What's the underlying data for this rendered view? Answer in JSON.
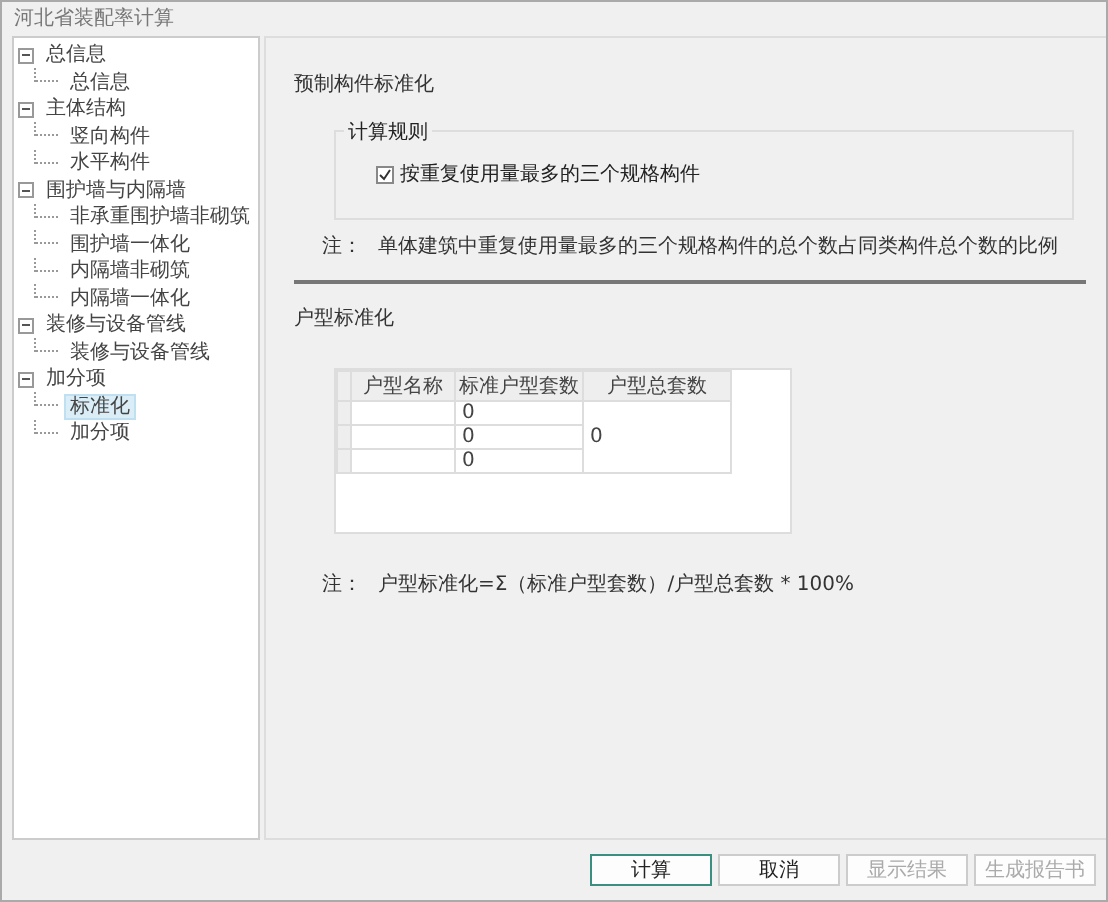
{
  "window": {
    "title": "河北省装配率计算"
  },
  "sidebar": {
    "items": [
      {
        "label": "总信息",
        "expanded": true,
        "selected": false,
        "children": [
          {
            "label": "总信息",
            "selected": false
          }
        ]
      },
      {
        "label": "主体结构",
        "expanded": true,
        "selected": false,
        "children": [
          {
            "label": "竖向构件",
            "selected": false
          },
          {
            "label": "水平构件",
            "selected": false
          }
        ]
      },
      {
        "label": "围护墙与内隔墙",
        "expanded": true,
        "selected": false,
        "children": [
          {
            "label": "非承重围护墙非砌筑",
            "selected": false
          },
          {
            "label": "围护墙一体化",
            "selected": false
          },
          {
            "label": "内隔墙非砌筑",
            "selected": false
          },
          {
            "label": "内隔墙一体化",
            "selected": false
          }
        ]
      },
      {
        "label": "装修与设备管线",
        "expanded": true,
        "selected": false,
        "children": [
          {
            "label": "装修与设备管线",
            "selected": false
          }
        ]
      },
      {
        "label": "加分项",
        "expanded": true,
        "selected": false,
        "children": [
          {
            "label": "标准化",
            "selected": true
          },
          {
            "label": "加分项",
            "selected": false
          }
        ]
      }
    ]
  },
  "prefab_section": {
    "title": "预制构件标准化",
    "group_title": "计算规则",
    "checkbox": {
      "label": "按重复使用量最多的三个规格构件",
      "checked": true
    },
    "note_label": "注：",
    "note": "单体建筑中重复使用量最多的三个规格构件的总个数占同类构件总个数的比例"
  },
  "unit_section": {
    "title": "户型标准化",
    "table": {
      "columns": [
        "户型名称",
        "标准户型套数",
        "户型总套数"
      ],
      "rows": [
        {
          "name": "",
          "count": "0"
        },
        {
          "name": "",
          "count": "0"
        },
        {
          "name": "",
          "count": "0"
        }
      ],
      "total": "0"
    },
    "note_label": "注：",
    "note": "户型标准化=Σ（标准户型套数）/户型总套数 * 100%"
  },
  "buttons": [
    {
      "label": "计算",
      "default": true,
      "disabled": false
    },
    {
      "label": "取消",
      "default": false,
      "disabled": false
    },
    {
      "label": "显示结果",
      "default": false,
      "disabled": true
    },
    {
      "label": "生成报告书",
      "default": false,
      "disabled": true
    }
  ]
}
